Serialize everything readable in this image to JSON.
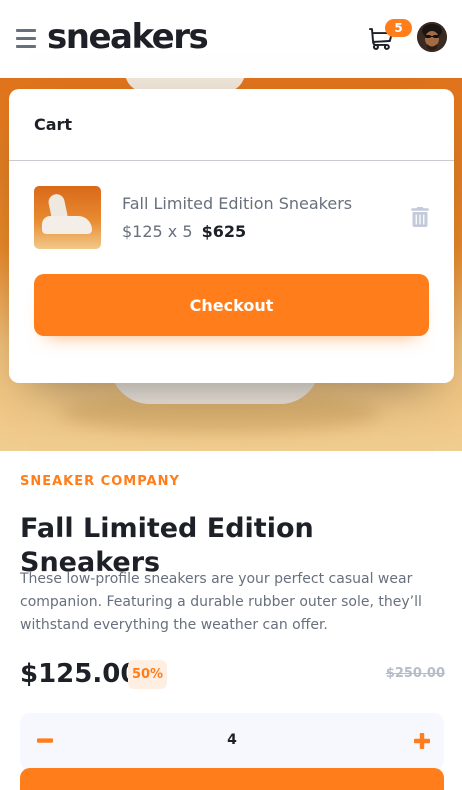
{
  "header": {
    "logo": "sneakers",
    "cart_count": "5"
  },
  "cart": {
    "title": "Cart",
    "item": {
      "name": "Fall Limited Edition Sneakers",
      "unit_price_qty": "$125 x 5",
      "total": "$625"
    },
    "checkout_label": "Checkout"
  },
  "product": {
    "company": "SNEAKER COMPANY",
    "title": "Fall Limited Edition Sneakers",
    "description": "These low-profile sneakers are your perfect casual wear companion. Featuring a durable rubber outer sole, they’ll withstand everything the weather can offer.",
    "price": "$125.00",
    "discount": "50%",
    "old_price": "$250.00"
  },
  "quantity": {
    "value": "4"
  },
  "colors": {
    "accent": "#ff7e1b",
    "accent_pale": "#ffeee2",
    "dark": "#1d2026",
    "gray": "#68707d",
    "light_gray": "#b6bcc8",
    "qty_bg": "#f6f8fd"
  },
  "icons": {
    "menu": "menu-icon",
    "cart": "cart-icon",
    "delete": "trash-icon",
    "minus": "minus-icon",
    "plus": "plus-icon"
  }
}
